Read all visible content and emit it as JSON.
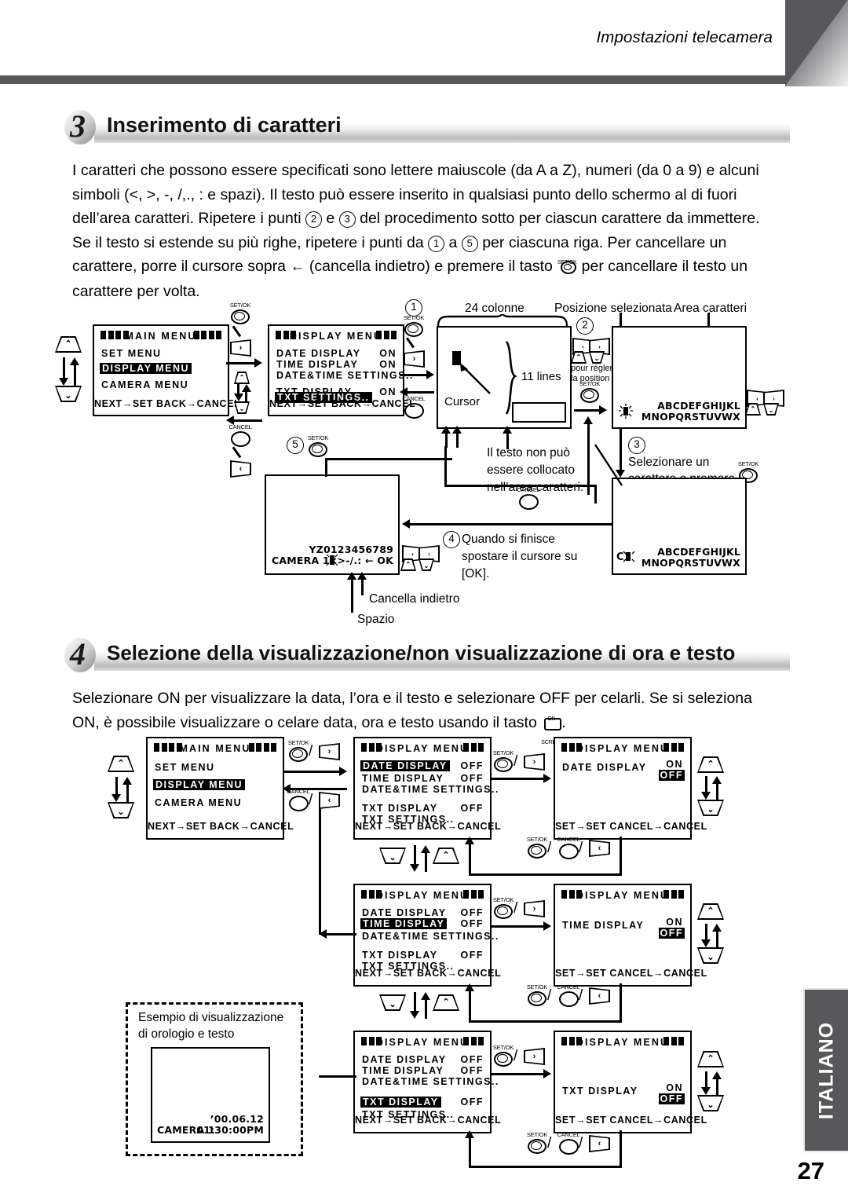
{
  "header": {
    "running_title": "Impostazioni telecamera"
  },
  "footer": {
    "language_tab": "ITALIANO",
    "page_number": "27"
  },
  "sections": [
    {
      "number": "3",
      "title": "Inserimento di caratteri",
      "body_parts": {
        "p1": "I caratteri che possono essere specificati sono lettere maiuscole (da A a Z), numeri (da 0 a 9) e alcuni simboli (<, >, -, /,., : e spazi). Il testo può essere inserito in qualsiasi punto dello schermo al di fuori dell’area caratteri. Ripetere i punti ",
        "c2": "2",
        "p2": " e ",
        "c3": "3",
        "p3": " del procedimento sotto per ciascun carattere da immettere. Se il testo si estende su più righe, ripetere i punti da ",
        "c1": "1",
        "p4": " a ",
        "c5": "5",
        "p5": " per ciascuna riga. Per cancellare un carattere, porre il cursore sopra ",
        "arrow": "←",
        "p6": " (cancella indietro) e premere il tasto ",
        "p7": " per cancellare il testo un carattere per volta."
      }
    },
    {
      "number": "4",
      "title": "Selezione della visualizzazione/non visualizzazione di ora e testo",
      "body_parts": {
        "p1": "Selezionare ON per visualizzare la data, l’ora e il testo e selezionare OFF per celarli. Se si seleziona ON, è possibile visualizzare o celare data, ora e testo usando il tasto ",
        "p2": "."
      },
      "onscreen_cap": "ON SCREEN"
    }
  ],
  "buttons": {
    "setok": "SET/OK",
    "cancel": "CANCEL",
    "up": "⌃",
    "down": "⌄",
    "left": "‹",
    "right": "›",
    "slash": "/"
  },
  "diagram3": {
    "main_menu": {
      "title": "MAIN  MENU",
      "rows": [
        {
          "label": "SET MENU",
          "selected": false
        },
        {
          "label": "DISPLAY MENU",
          "selected": true
        },
        {
          "label": "CAMERA MENU",
          "selected": false
        }
      ],
      "footer": "NEXT→SET   BACK→CANCEL"
    },
    "display_menu": {
      "title": "DISPLAY MENU",
      "rows": [
        {
          "label": "DATE DISPLAY",
          "value": "ON",
          "selected": false
        },
        {
          "label": "TIME DISPLAY",
          "value": "ON",
          "selected": false
        },
        {
          "label": "DATE&TIME SETTINGS..",
          "value": "",
          "selected": false
        },
        {
          "label": "TXT DISPLAY",
          "value": "ON",
          "selected": false
        },
        {
          "label": "TXT SETTINGS..",
          "value": "",
          "selected": true
        }
      ],
      "footer": "NEXT→SET   BACK→CANCEL"
    },
    "labels": {
      "columns": "24 colonne",
      "position_selected": "Posizione selezionata",
      "char_area": "Area caratteri",
      "cursor": "Cursor",
      "lines": "11 lines",
      "no_text_area": "Il testo non può essere collocato nell’area caratteri.",
      "pour_regler": "pour régler\nla position",
      "step3_text": "Selezionare un\ncarattere e premere",
      "step4_text": "Quando si finisce spostare il cursore su [OK].",
      "backspace": "Cancella indietro",
      "space": "Spazio"
    },
    "steps": {
      "s1": "1",
      "s2": "2",
      "s3": "3",
      "s4": "4",
      "s5": "5"
    },
    "char_area_rows": [
      "ABCDEFGHIJKL",
      "MNOPQRSTUVWX"
    ],
    "char_area_rows_selected": [
      "ABCDEFGHIJKL",
      "MNOPQRSTUVWX"
    ],
    "bottom_panel": {
      "camera_label": "CAMERA 1",
      "row1": "YZ0123456789",
      "row2": "<>-/.:  ←  OK"
    }
  },
  "diagram4": {
    "main_menu": {
      "title": "MAIN  MENU",
      "rows": [
        {
          "label": "SET MENU",
          "selected": false
        },
        {
          "label": "DISPLAY MENU",
          "selected": true
        },
        {
          "label": "CAMERA MENU",
          "selected": false
        }
      ],
      "footer": "NEXT→SET   BACK→CANCEL"
    },
    "menu_date": {
      "title": "DISPLAY MENU",
      "rows": [
        {
          "label": "DATE DISPLAY",
          "value": "OFF",
          "selected": true
        },
        {
          "label": "TIME DISPLAY",
          "value": "OFF",
          "selected": false
        },
        {
          "label": "DATE&TIME SETTINGS..",
          "value": "",
          "selected": false
        },
        {
          "label": "TXT DISPLAY",
          "value": "OFF",
          "selected": false
        },
        {
          "label": "TXT SETTINGS..",
          "value": "",
          "selected": false
        }
      ],
      "footer": "NEXT→SET   BACK→CANCEL"
    },
    "menu_time": {
      "title": "DISPLAY MENU",
      "rows": [
        {
          "label": "DATE DISPLAY",
          "value": "OFF",
          "selected": false
        },
        {
          "label": "TIME DISPLAY",
          "value": "OFF",
          "selected": true
        },
        {
          "label": "DATE&TIME SETTINGS..",
          "value": "",
          "selected": false
        },
        {
          "label": "TXT DISPLAY",
          "value": "OFF",
          "selected": false
        },
        {
          "label": "TXT SETTINGS..",
          "value": "",
          "selected": false
        }
      ],
      "footer": "NEXT→SET   BACK→CANCEL"
    },
    "menu_txt": {
      "title": "DISPLAY MENU",
      "rows": [
        {
          "label": "DATE DISPLAY",
          "value": "OFF",
          "selected": false
        },
        {
          "label": "TIME DISPLAY",
          "value": "OFF",
          "selected": false
        },
        {
          "label": "DATE&TIME SETTINGS..",
          "value": "",
          "selected": false
        },
        {
          "label": "TXT DISPLAY",
          "value": "OFF",
          "selected": true
        },
        {
          "label": "TXT SETTINGS..",
          "value": "",
          "selected": false
        }
      ],
      "footer": "NEXT→SET   BACK→CANCEL"
    },
    "toggle_date": {
      "title": "DISPLAY MENU",
      "label": "DATE DISPLAY",
      "on": "ON",
      "off": "OFF",
      "footer": "SET→SET CANCEL→CANCEL"
    },
    "toggle_time": {
      "title": "DISPLAY MENU",
      "label": "TIME DISPLAY",
      "on": "ON",
      "off": "OFF",
      "footer": "SET→SET CANCEL→CANCEL"
    },
    "toggle_txt": {
      "title": "DISPLAY MENU",
      "label": "TXT DISPLAY",
      "on": "ON",
      "off": "OFF",
      "footer": "SET→SET CANCEL→CANCEL"
    },
    "example": {
      "caption": "Esempio di visualizzazione\ndi orologio e testo",
      "camera_label": "CAMERA 1",
      "date": "’00.06.12",
      "time": "01:30:00PM"
    }
  }
}
